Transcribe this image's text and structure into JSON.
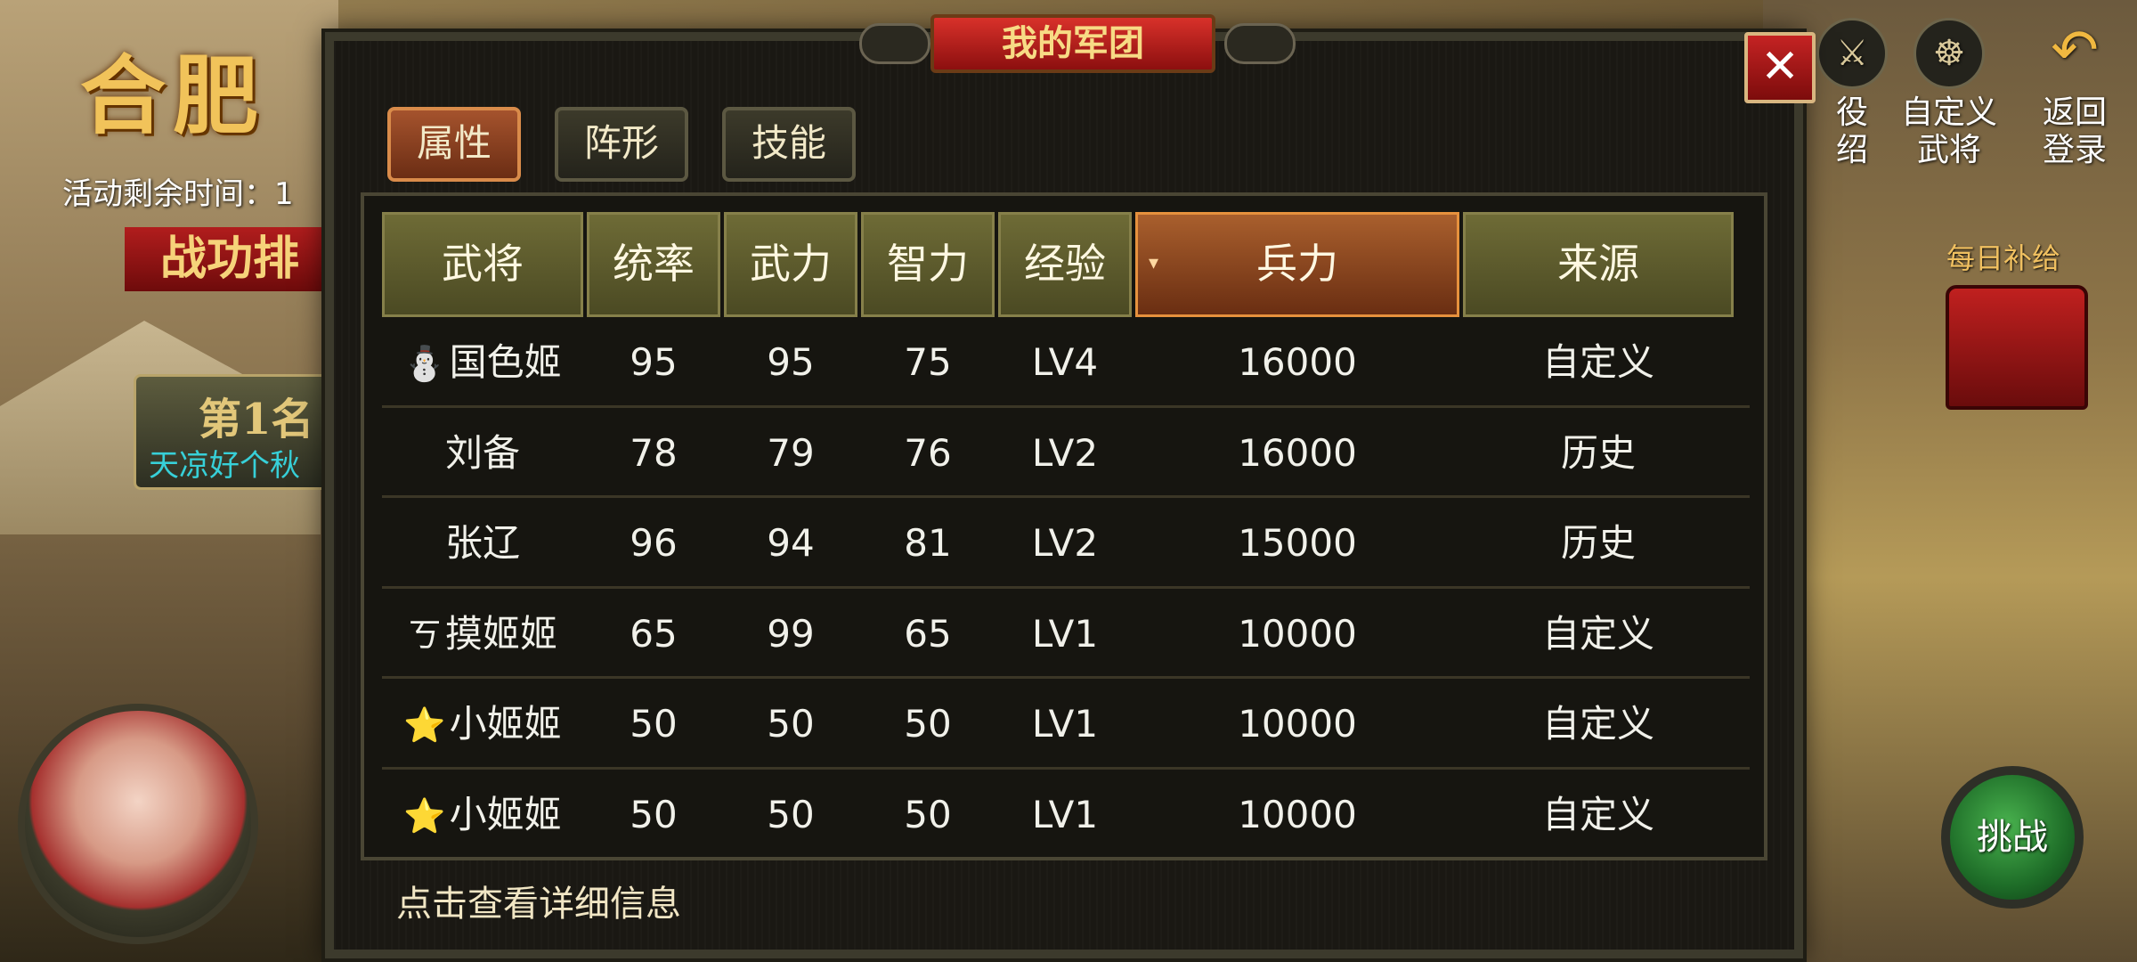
{
  "background": {
    "event_title": "合肥",
    "timer_label": "活动剩余时间：1",
    "ranking_banner": "战功排",
    "rank1_title": "第1名",
    "rank1_name": "天凉好个秋",
    "top_buttons": [
      {
        "label": "役\n绍",
        "icon": "campaign-icon"
      },
      {
        "label": "自定义\n武将",
        "icon": "custom-general-icon"
      },
      {
        "label": "返回\n登录",
        "icon": "back-arrow-icon"
      }
    ],
    "daily_supply_label": "每日补给",
    "challenge_label": "挑战"
  },
  "dialog": {
    "title": "我的军团",
    "close_symbol": "✕",
    "tabs": [
      {
        "label": "属性",
        "active": true
      },
      {
        "label": "阵形",
        "active": false
      },
      {
        "label": "技能",
        "active": false
      }
    ],
    "table": {
      "columns": [
        "武将",
        "统率",
        "武力",
        "智力",
        "经验",
        "兵力",
        "来源"
      ],
      "sorted_column": "兵力",
      "sort_indicator": "▾",
      "rows": [
        {
          "icon": "⛄",
          "name": "国色姬",
          "lead": "95",
          "force": "95",
          "intel": "75",
          "exp": "LV4",
          "troops": "16000",
          "source": "自定义"
        },
        {
          "icon": "",
          "name": "刘备",
          "lead": "78",
          "force": "79",
          "intel": "76",
          "exp": "LV2",
          "troops": "16000",
          "source": "历史"
        },
        {
          "icon": "",
          "name": "张辽",
          "lead": "96",
          "force": "94",
          "intel": "81",
          "exp": "LV2",
          "troops": "15000",
          "source": "历史"
        },
        {
          "icon": "ㄎ",
          "name": "摸姬姬",
          "lead": "65",
          "force": "99",
          "intel": "65",
          "exp": "LV1",
          "troops": "10000",
          "source": "自定义"
        },
        {
          "icon": "⭐",
          "name": "小姬姬",
          "lead": "50",
          "force": "50",
          "intel": "50",
          "exp": "LV1",
          "troops": "10000",
          "source": "自定义"
        },
        {
          "icon": "⭐",
          "name": "小姬姬",
          "lead": "50",
          "force": "50",
          "intel": "50",
          "exp": "LV1",
          "troops": "10000",
          "source": "自定义"
        }
      ]
    },
    "footer_hint": "点击查看详细信息"
  },
  "colors": {
    "active_tab": "#a5532d",
    "header_cell": "#6e6b36",
    "sorted_header": "#a95f2d",
    "close_button": "#c52323",
    "title_plaque": "#d8312a"
  }
}
